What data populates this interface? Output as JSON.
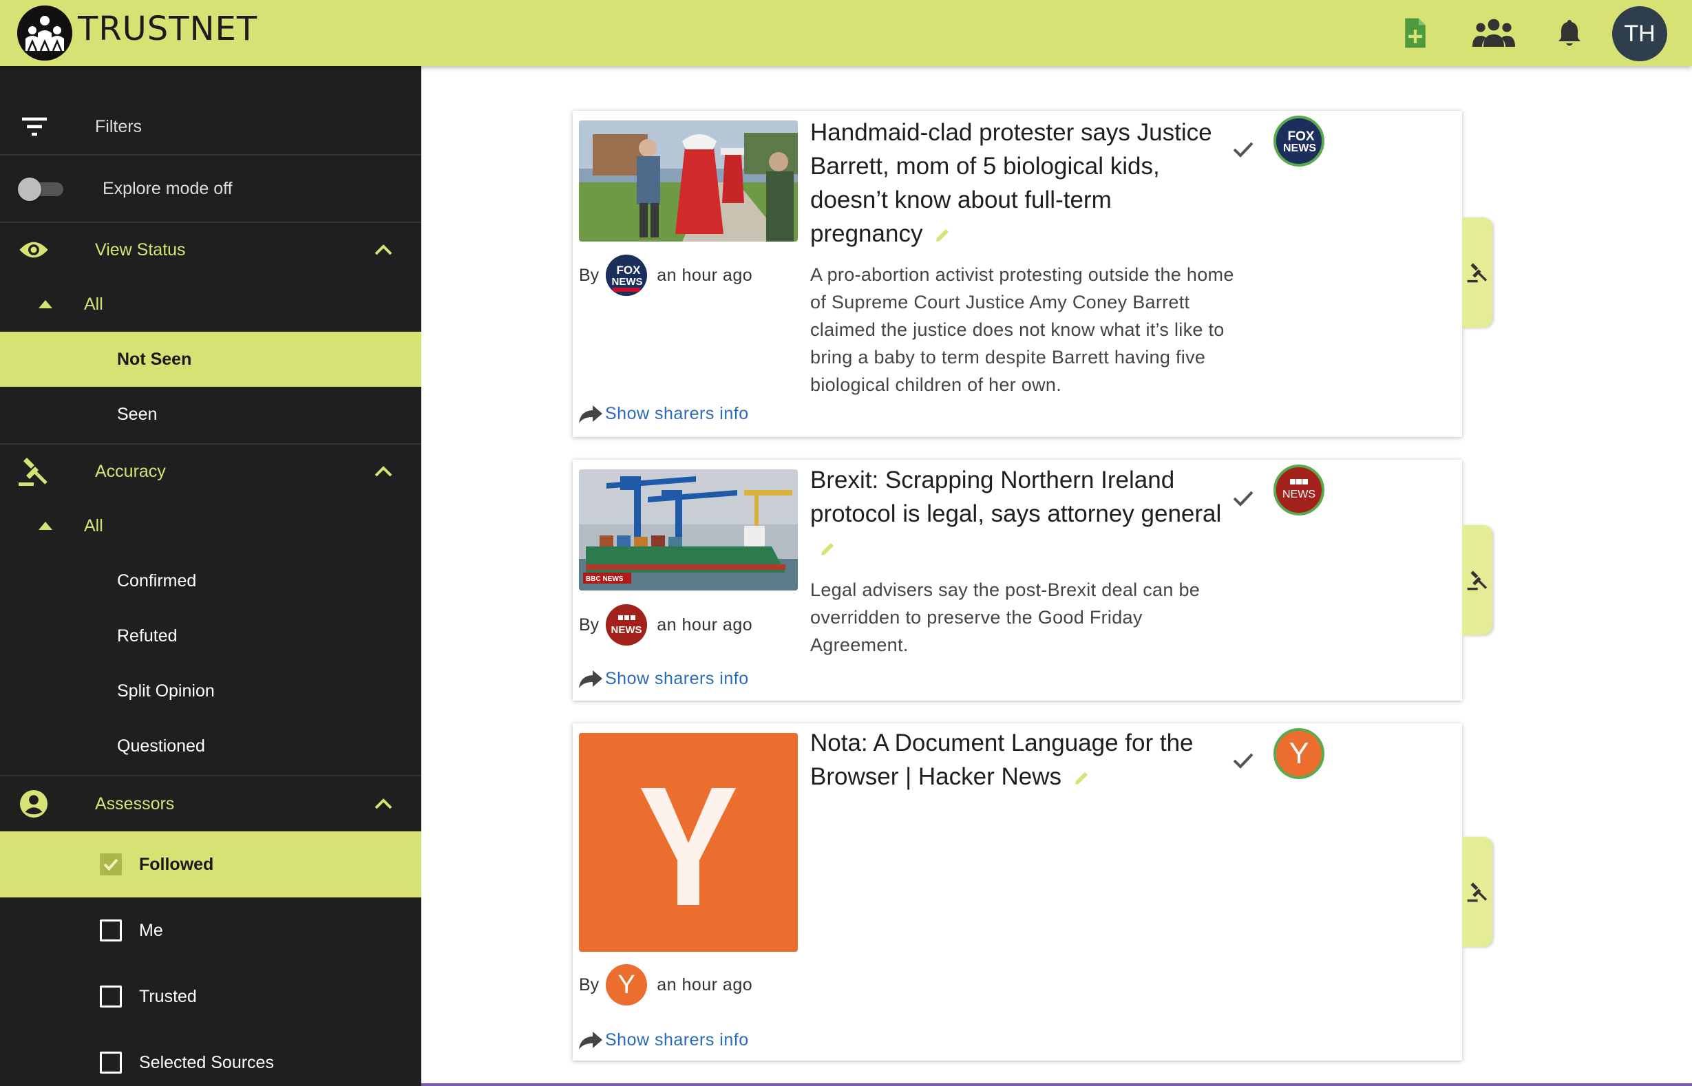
{
  "app": {
    "brand": "TRUSTNET",
    "avatar_initials": "TH"
  },
  "colors": {
    "accent": "#d6e274",
    "sidebar": "#1f1f1f",
    "link": "#2a6bb8"
  },
  "toolbar": {
    "icons": [
      "add-article-icon",
      "people-icon",
      "bell-icon"
    ]
  },
  "sidebar": {
    "filters_label": "Filters",
    "explore_label": "Explore mode off",
    "view_status": {
      "label": "View Status",
      "all": "All",
      "items": [
        "Not Seen",
        "Seen"
      ],
      "selected": "Not Seen"
    },
    "accuracy": {
      "label": "Accuracy",
      "all": "All",
      "items": [
        "Confirmed",
        "Refuted",
        "Split Opinion",
        "Questioned"
      ]
    },
    "assessors": {
      "label": "Assessors",
      "items": [
        "Followed",
        "Me",
        "Trusted",
        "Selected Sources"
      ],
      "checked": [
        "Followed"
      ]
    }
  },
  "articles": [
    {
      "title": "Handmaid-clad protester says Justice Barrett, mom of 5 biological kids, doesn’t know about full-term pregnancy",
      "description": "A pro-abortion activist protesting outside the home of Supreme Court Justice Amy Coney Barrett claimed the justice does not know what it’s like to bring a baby to term despite Barrett having five biological children of her own.",
      "by": "By",
      "time": "an hour ago",
      "share": "Show sharers info",
      "source": "FOX NEWS"
    },
    {
      "title": "Brexit: Scrapping Northern Ireland protocol is legal, says attorney general",
      "description": "Legal advisers say the post-Brexit deal can be overridden to preserve the Good Friday Agreement.",
      "by": "By",
      "time": "an hour ago",
      "share": "Show sharers info",
      "source": "BBC NEWS",
      "thumb_caption": "BBC NEWS"
    },
    {
      "title": "Nota: A Document Language for the Browser | Hacker News",
      "description": "",
      "by": "By",
      "time": "an hour ago",
      "share": "Show sharers info",
      "source": "Y"
    }
  ]
}
